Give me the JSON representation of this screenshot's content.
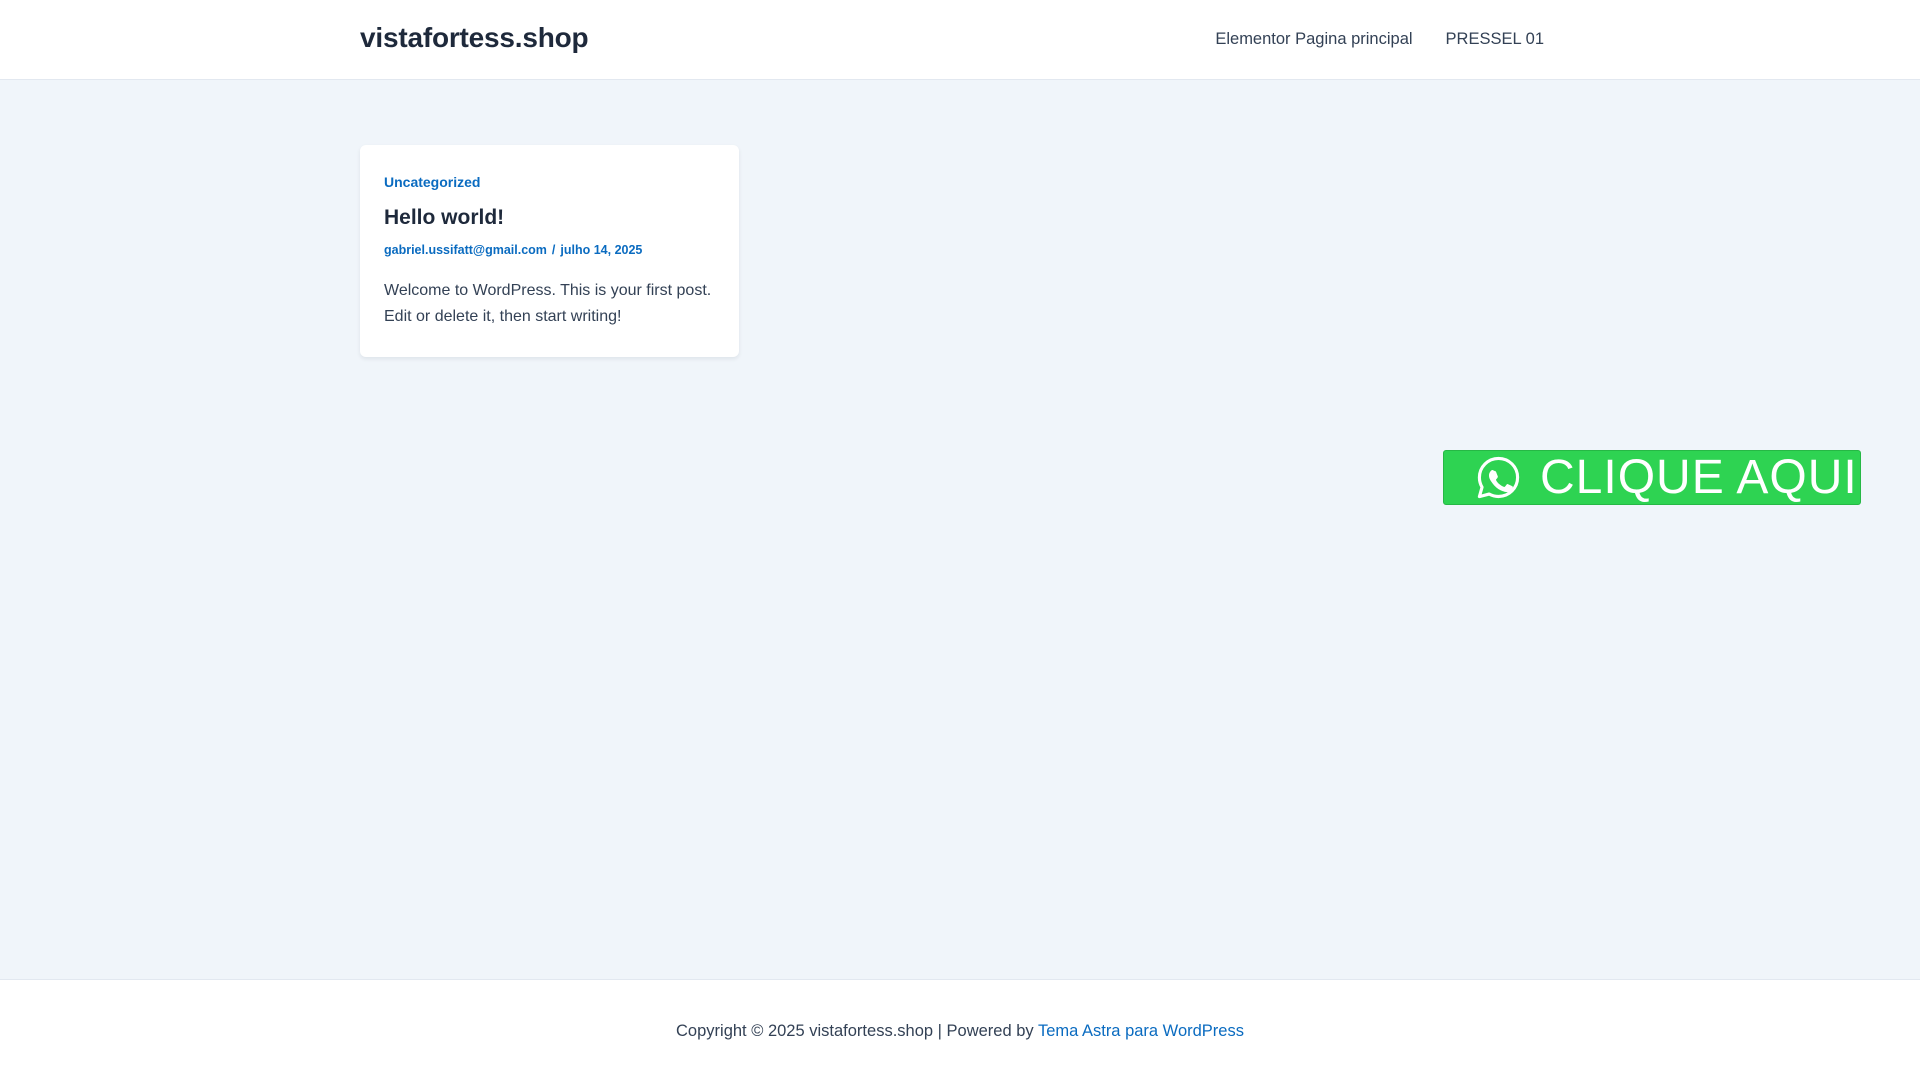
{
  "header": {
    "site_title": "vistafortess.shop",
    "nav": [
      {
        "label": "Elementor Pagina principal"
      },
      {
        "label": "PRESSEL 01"
      }
    ]
  },
  "post": {
    "category": "Uncategorized",
    "title": "Hello world!",
    "author": "gabriel.ussifatt@gmail.com",
    "meta_separator": "/",
    "date": "julho 14, 2025",
    "excerpt": "Welcome to WordPress. This is your first post. Edit or delete it, then start writing!"
  },
  "whatsapp_button": {
    "label": "CLIQUE AQUI",
    "icon": "whatsapp-icon",
    "color": "#2ed352"
  },
  "footer": {
    "copyright": "Copyright © 2025 vistafortess.shop | Powered by",
    "theme_link": "Tema Astra para WordPress"
  },
  "colors": {
    "background": "#f0f5fa",
    "accent": "#0a6bc0",
    "heading": "#1e293b",
    "text": "#334155"
  }
}
